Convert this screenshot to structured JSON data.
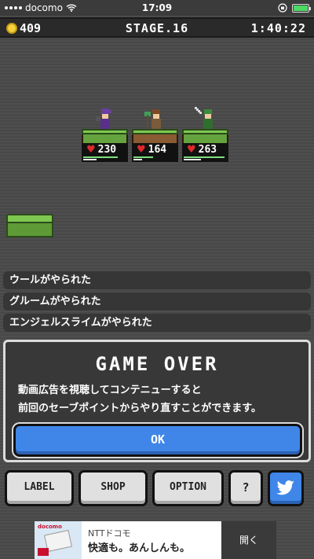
{
  "status_bar": {
    "carrier": "docomo",
    "time": "17:09"
  },
  "hud": {
    "coins": "409",
    "stage": "STAGE.16",
    "timer": "1:40:22"
  },
  "party": [
    {
      "hp": "230",
      "hp_fraction": 0.8,
      "mp_fraction": 0.3
    },
    {
      "hp": "164",
      "hp_fraction": 0.45,
      "mp_fraction": 0.2
    },
    {
      "hp": "263",
      "hp_fraction": 0.95,
      "mp_fraction": 0.4
    }
  ],
  "log": [
    "ウールがやられた",
    "グルームがやられた",
    "エンジェルスライムがやられた"
  ],
  "game_over": {
    "title": "GAME OVER",
    "line1": "動画広告を視聴してコンテニューすると",
    "line2": "前回のセーブポイントからやり直すことができます。",
    "ok": "OK"
  },
  "buttons": {
    "label": "LABEL",
    "shop": "SHOP",
    "option": "OPTION",
    "help": "?"
  },
  "ad": {
    "brand": "NTTドコモ",
    "headline": "快適も。あんしんも。",
    "cta": "開く"
  },
  "colors": {
    "accent_blue": "#3f86e8",
    "heart": "#e02a2a",
    "coin": "#f4d23b"
  },
  "icons": {
    "twitter": "twitter-bird-icon",
    "wifi": "wifi-icon",
    "battery": "battery-icon"
  }
}
